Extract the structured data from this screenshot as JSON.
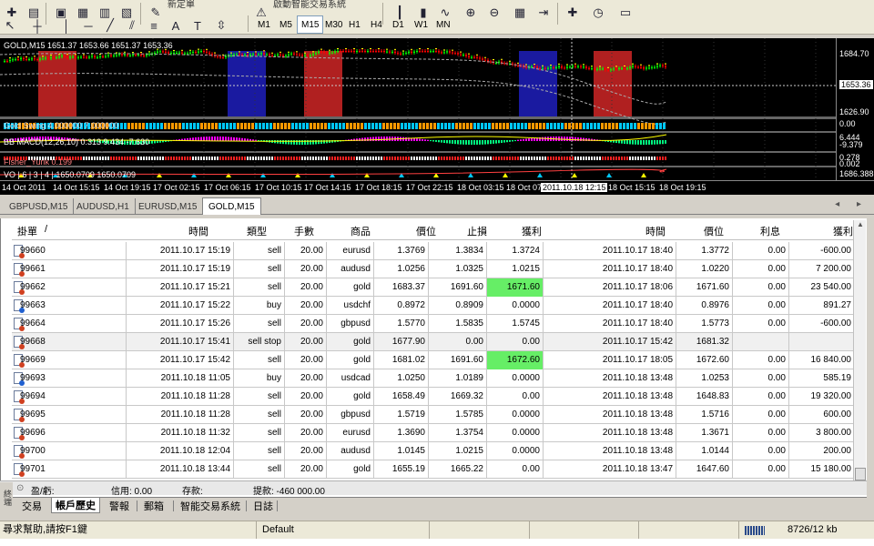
{
  "toolbar": {
    "new_order_label": "新定單",
    "expert_label": "啟動智能交易系統",
    "timeframes": [
      "M1",
      "M5",
      "M15",
      "M30",
      "H1",
      "H4",
      "D1",
      "W1",
      "MN"
    ],
    "active_timeframe": "M15"
  },
  "chart": {
    "title": "GOLD,M15  1651.37 1653.66 1651.37 1653.36",
    "indicators": {
      "ind1": "Gold Swing 4.000000 7.000000",
      "macd": "BB MACD(12,26,10) 0.313 9.434 -7.630",
      "fisher": "Fisher_Yurik 0.199",
      "vo": "VO | 6 | 3 | 4 | 1650.0709 1650.0709"
    },
    "price_labels": {
      "p1": "1684.70",
      "current": "1653.36",
      "p2": "1626.90",
      "ind1_top": "0.00",
      "macd_a": "6.444",
      "macd_b": "-9.379",
      "fisher_a": "0.278",
      "fisher_b": "0.002",
      "vo": "1686.388"
    },
    "time_labels": [
      "14 Oct 2011",
      "14 Oct 15:15",
      "14 Oct 19:15",
      "17 Oct 02:15",
      "17 Oct 06:15",
      "17 Oct 10:15",
      "17 Oct 14:15",
      "17 Oct 18:15",
      "17 Oct 22:15",
      "18 Oct 03:15",
      "18 Oct 07",
      "2011.10.18 12:15",
      "18 Oct 15:15",
      "18 Oct 19:15"
    ],
    "colors": {
      "band_red": "#b02020",
      "band_blue": "#1a1aa0",
      "candle_up": "#00ff00",
      "candle_down": "#ff0000"
    }
  },
  "chart_tabs": {
    "tabs": [
      "GBPUSD,M15",
      "AUDUSD,H1",
      "EURUSD,M15",
      "GOLD,M15"
    ],
    "active": "GOLD,M15",
    "arrows": "◂ ▸"
  },
  "table": {
    "headers": {
      "order": "掛單",
      "sort": "/",
      "open_time": "時間",
      "type": "類型",
      "size": "手數",
      "symbol": "商品",
      "price": "價位",
      "sl": "止損",
      "tp": "獲利",
      "close_time": "時間",
      "close_price": "價位",
      "swap": "利息",
      "profit": "獲利"
    },
    "rows": [
      {
        "order": "99660",
        "open_time": "2011.10.17 15:19",
        "type": "sell",
        "size": "20.00",
        "symbol": "eurusd",
        "price": "1.3769",
        "sl": "1.3834",
        "tp": "1.3724",
        "close_time": "2011.10.17 18:40",
        "close_price": "1.3772",
        "swap": "0.00",
        "profit": "-600.00",
        "tp_hl": false,
        "side": "sell"
      },
      {
        "order": "99661",
        "open_time": "2011.10.17 15:19",
        "type": "sell",
        "size": "20.00",
        "symbol": "audusd",
        "price": "1.0256",
        "sl": "1.0325",
        "tp": "1.0215",
        "close_time": "2011.10.17 18:40",
        "close_price": "1.0220",
        "swap": "0.00",
        "profit": "7 200.00",
        "tp_hl": false,
        "side": "sell"
      },
      {
        "order": "99662",
        "open_time": "2011.10.17 15:21",
        "type": "sell",
        "size": "20.00",
        "symbol": "gold",
        "price": "1683.37",
        "sl": "1691.60",
        "tp": "1671.60",
        "close_time": "2011.10.17 18:06",
        "close_price": "1671.60",
        "swap": "0.00",
        "profit": "23 540.00",
        "tp_hl": true,
        "side": "sell"
      },
      {
        "order": "99663",
        "open_time": "2011.10.17 15:22",
        "type": "buy",
        "size": "20.00",
        "symbol": "usdchf",
        "price": "0.8972",
        "sl": "0.8909",
        "tp": "0.0000",
        "close_time": "2011.10.17 18:40",
        "close_price": "0.8976",
        "swap": "0.00",
        "profit": "891.27",
        "tp_hl": false,
        "side": "buy"
      },
      {
        "order": "99664",
        "open_time": "2011.10.17 15:26",
        "type": "sell",
        "size": "20.00",
        "symbol": "gbpusd",
        "price": "1.5770",
        "sl": "1.5835",
        "tp": "1.5745",
        "close_time": "2011.10.17 18:40",
        "close_price": "1.5773",
        "swap": "0.00",
        "profit": "-600.00",
        "tp_hl": false,
        "side": "sell"
      },
      {
        "order": "99668",
        "open_time": "2011.10.17 15:41",
        "type": "sell stop",
        "size": "20.00",
        "symbol": "gold",
        "price": "1677.90",
        "sl": "0.00",
        "tp": "0.00",
        "close_time": "2011.10.17 15:42",
        "close_price": "1681.32",
        "swap": "",
        "profit": "",
        "tp_hl": false,
        "side": "none",
        "row_bg": "#f0f0f0"
      },
      {
        "order": "99669",
        "open_time": "2011.10.17 15:42",
        "type": "sell",
        "size": "20.00",
        "symbol": "gold",
        "price": "1681.02",
        "sl": "1691.60",
        "tp": "1672.60",
        "close_time": "2011.10.17 18:05",
        "close_price": "1672.60",
        "swap": "0.00",
        "profit": "16 840.00",
        "tp_hl": true,
        "side": "sell"
      },
      {
        "order": "99693",
        "open_time": "2011.10.18 11:05",
        "type": "buy",
        "size": "20.00",
        "symbol": "usdcad",
        "price": "1.0250",
        "sl": "1.0189",
        "tp": "0.0000",
        "close_time": "2011.10.18 13:48",
        "close_price": "1.0253",
        "swap": "0.00",
        "profit": "585.19",
        "tp_hl": false,
        "side": "buy"
      },
      {
        "order": "99694",
        "open_time": "2011.10.18 11:28",
        "type": "sell",
        "size": "20.00",
        "symbol": "gold",
        "price": "1658.49",
        "sl": "1669.32",
        "tp": "0.00",
        "close_time": "2011.10.18 13:48",
        "close_price": "1648.83",
        "swap": "0.00",
        "profit": "19 320.00",
        "tp_hl": false,
        "side": "sell"
      },
      {
        "order": "99695",
        "open_time": "2011.10.18 11:28",
        "type": "sell",
        "size": "20.00",
        "symbol": "gbpusd",
        "price": "1.5719",
        "sl": "1.5785",
        "tp": "0.0000",
        "close_time": "2011.10.18 13:48",
        "close_price": "1.5716",
        "swap": "0.00",
        "profit": "600.00",
        "tp_hl": false,
        "side": "sell"
      },
      {
        "order": "99696",
        "open_time": "2011.10.18 11:32",
        "type": "sell",
        "size": "20.00",
        "symbol": "eurusd",
        "price": "1.3690",
        "sl": "1.3754",
        "tp": "0.0000",
        "close_time": "2011.10.18 13:48",
        "close_price": "1.3671",
        "swap": "0.00",
        "profit": "3 800.00",
        "tp_hl": false,
        "side": "sell"
      },
      {
        "order": "99700",
        "open_time": "2011.10.18 12:04",
        "type": "sell",
        "size": "20.00",
        "symbol": "audusd",
        "price": "1.0145",
        "sl": "1.0215",
        "tp": "0.0000",
        "close_time": "2011.10.18 13:48",
        "close_price": "1.0144",
        "swap": "0.00",
        "profit": "200.00",
        "tp_hl": false,
        "side": "sell"
      },
      {
        "order": "99701",
        "open_time": "2011.10.18 13:44",
        "type": "sell",
        "size": "20.00",
        "symbol": "gold",
        "price": "1655.19",
        "sl": "1665.22",
        "tp": "0.00",
        "close_time": "2011.10.18 13:47",
        "close_price": "1647.60",
        "swap": "0.00",
        "profit": "15 180.00",
        "tp_hl": false,
        "side": "sell"
      }
    ],
    "highlight_color": "#66ee66"
  },
  "summary": {
    "icon": "⊙",
    "profit_label": "盈/虧:",
    "credit": "信用: 0.00",
    "deposit": "存款:",
    "withdraw": "提款: -460 000.00"
  },
  "terminal_side": "終端",
  "bottom_tabs": [
    "交易",
    "帳戶歷史",
    "警報",
    "郵箱",
    "智能交易系統",
    "日誌"
  ],
  "active_bottom_tab": "帳戶歷史",
  "status": {
    "help": "尋求幫助,請按F1鍵",
    "profile": "Default",
    "traffic": "8726/12 kb"
  }
}
